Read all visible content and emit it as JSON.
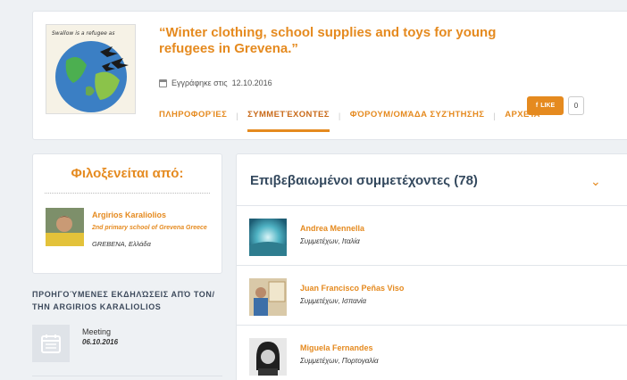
{
  "event": {
    "title": "“Winter clothing, school supplies and toys for young refugees in Grevena.”",
    "registered_label": "Εγγράφηκε στις",
    "registered_date": "12.10.2016",
    "thumb_caption": "Swallow is a refugee as"
  },
  "tabs": [
    {
      "label": "ΠΛΗΡΟΦΟΡΊΕΣ"
    },
    {
      "label": "ΣΥΜΜΕΤΈΧΟΝΤΕΣ"
    },
    {
      "label": "ΦΌΡΟΥΜ/ΟΜΆΔΑ ΣΥΖΉΤΗΣΗΣ"
    },
    {
      "label": "ΑΡΧΕΊΑ"
    }
  ],
  "like": {
    "label": "LIKE",
    "count": "0"
  },
  "host": {
    "heading": "Φιλοξενείται από:",
    "name": "Argirios Karaliolios",
    "school": "2nd primary school of Grevena Greece",
    "location": "GREBENA, Ελλάδα"
  },
  "previous": {
    "heading": "ΠΡΟΗΓΟΎΜΕΝΕΣ ΕΚΔΗΛΏΣΕΙΣ ΑΠΌ ΤΟΝ/ΤΗΝ ARGIRIOS KARALIOLIOS",
    "items": [
      {
        "type": "Meeting",
        "date": "06.10.2016"
      }
    ]
  },
  "participants": {
    "title": "Επιβεβαιωμένοι συμμετέχοντες (78)",
    "rows": [
      {
        "name": "Andrea Mennella",
        "role": "Συμμετέχων, Ιταλία"
      },
      {
        "name": "Juan Francisco Peñas Viso",
        "role": "Συμμετέχων, Ισπανία"
      },
      {
        "name": "Miguela Fernandes",
        "role": "Συμμετέχων, Πορτογαλία"
      }
    ]
  },
  "colors": {
    "accent": "#e58a1f",
    "heading": "#34495e",
    "background": "#eef1f4"
  }
}
